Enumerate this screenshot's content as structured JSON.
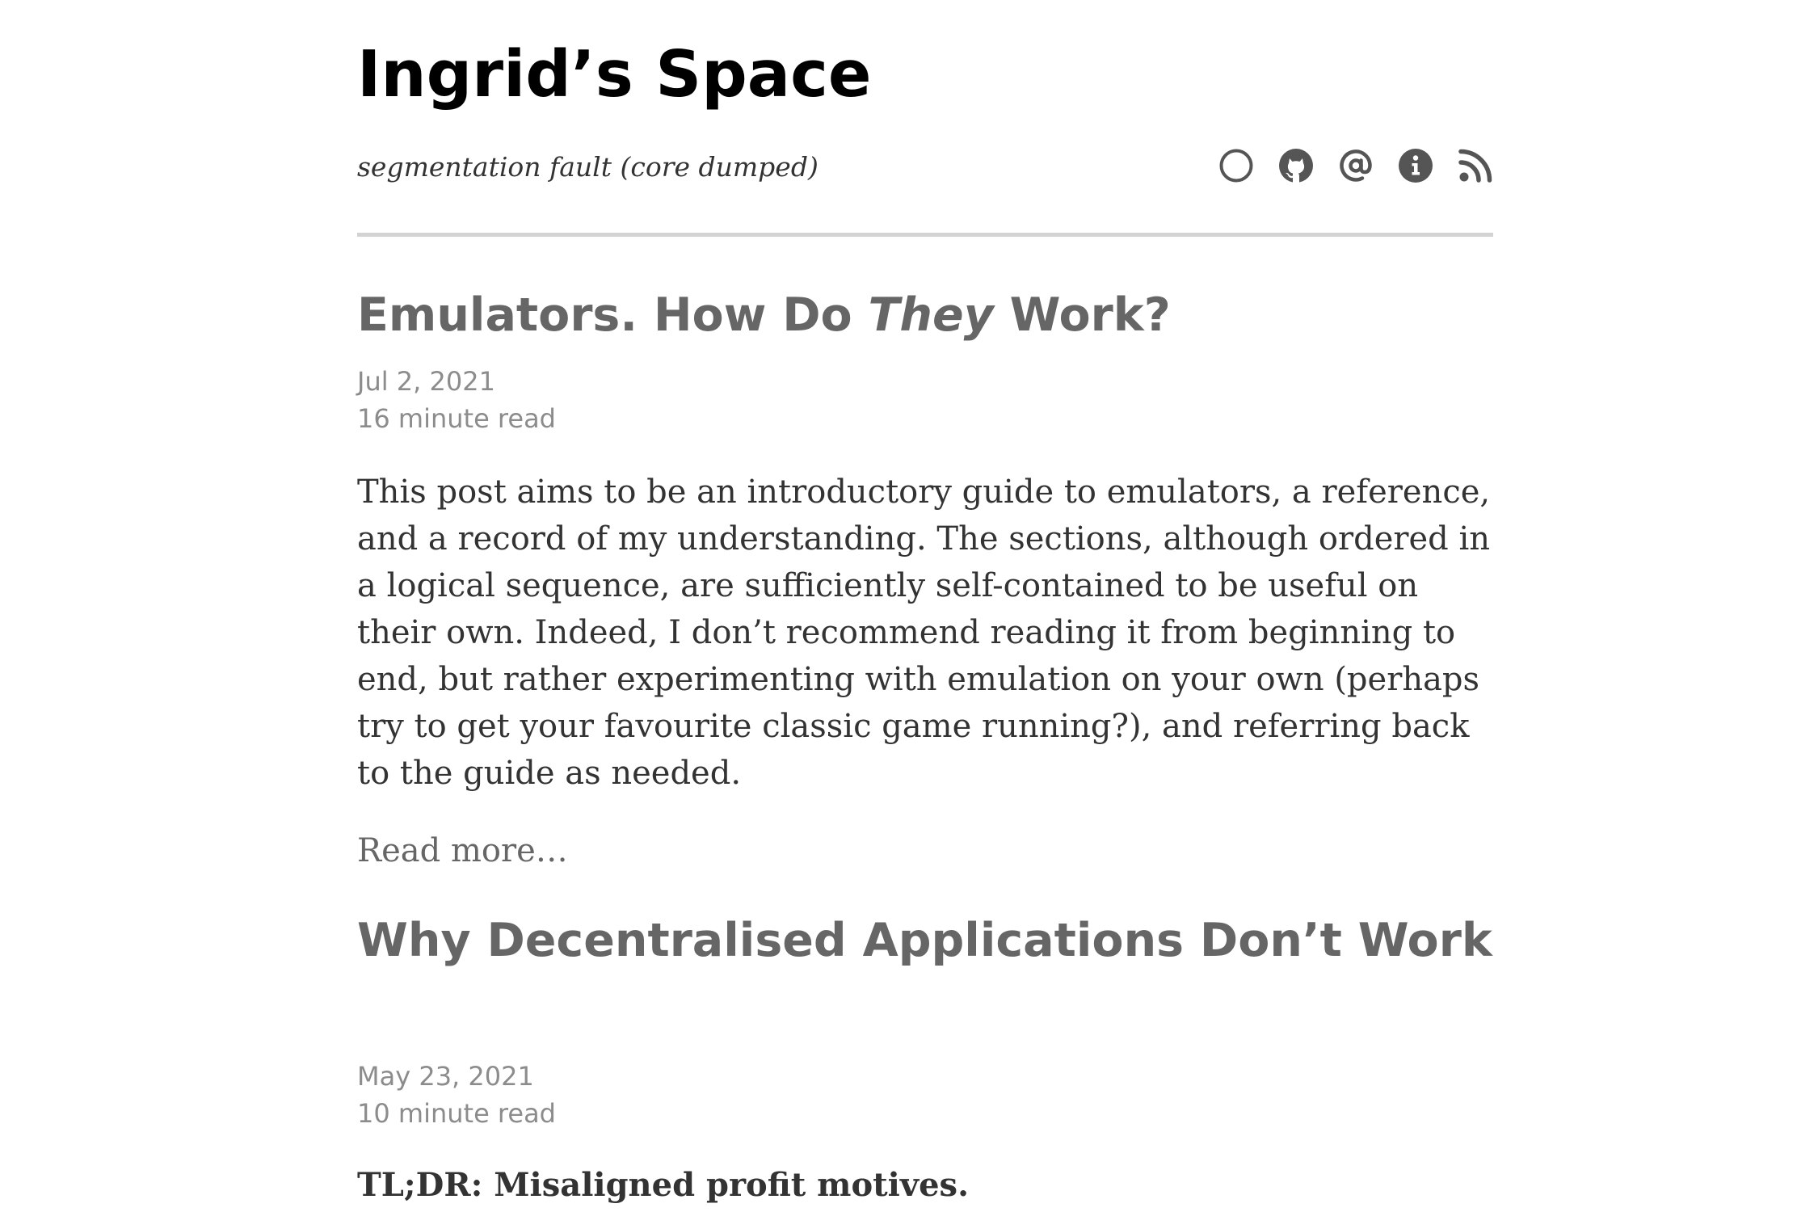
{
  "site": {
    "title": "Ingrid’s Space",
    "tagline": "segmentation fault (core dumped)",
    "nav_icons": [
      "circle-icon",
      "github-icon",
      "at-sign-icon",
      "info-icon",
      "rss-icon"
    ]
  },
  "posts": [
    {
      "title_before": "Emulators. How Do ",
      "title_em": "They",
      "title_after": " Work?",
      "date": "Jul 2, 2021",
      "read_time": "16 minute read",
      "excerpt": "This post aims to be an introductory guide to emulators, a reference, and a record of my understanding. The sections, although ordered in a logical sequence, are sufficiently self-contained to be useful on their own. Indeed, I don’t recommend reading it from beginning to end, but rather experimenting with emulation on your own (perhaps try to get your favourite classic game running?), and referring back to the guide as needed.",
      "read_more": "Read more…"
    },
    {
      "title": "Why Decentralised Applications Don’t Work",
      "date": "May 23, 2021",
      "read_time": "10 minute read",
      "excerpt": "TL;DR: Misaligned profit motives."
    }
  ],
  "colors": {
    "title": "#000000",
    "post_title": "#666666",
    "meta": "#8c8c8c",
    "body_text": "#333333",
    "icon": "#555555",
    "rule": "#d3d3d3"
  }
}
